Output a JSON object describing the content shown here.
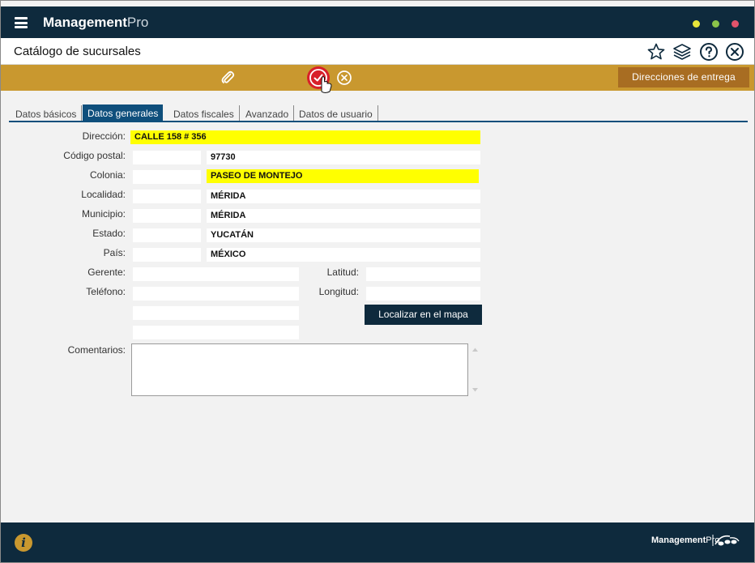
{
  "app": {
    "name_bold": "Management",
    "name_light": "Pro"
  },
  "window_controls": {
    "minimize_color": "#e8e53a",
    "maximize_color": "#8bc34a",
    "close_color": "#e2536b"
  },
  "header": {
    "title": "Catálogo de sucursales"
  },
  "header_icons": [
    "star-icon",
    "layers-icon",
    "help-icon",
    "close-icon"
  ],
  "actionbar": {
    "icons": [
      "paperclip-icon",
      "check-icon",
      "cancel-icon"
    ],
    "direcciones_label": "Direcciones de entrega"
  },
  "tabs": [
    {
      "label": "Datos básicos",
      "active": false
    },
    {
      "label": "Datos generales",
      "active": true
    },
    {
      "label": "Datos fiscales",
      "active": false
    },
    {
      "label": "Avanzado",
      "active": false
    },
    {
      "label": "Datos de usuario",
      "active": false
    }
  ],
  "form": {
    "direccion": {
      "label": "Dirección:",
      "value": "CALLE 158 # 356"
    },
    "codigo_postal": {
      "label": "Código postal:",
      "code": "",
      "value": "97730"
    },
    "colonia": {
      "label": "Colonia:",
      "code": "",
      "value": "PASEO DE MONTEJO"
    },
    "localidad": {
      "label": "Localidad:",
      "code": "",
      "value": "MÉRIDA"
    },
    "municipio": {
      "label": "Municipio:",
      "code": "",
      "value": "MÉRIDA"
    },
    "estado": {
      "label": "Estado:",
      "code": "",
      "value": "YUCATÁN"
    },
    "pais": {
      "label": "País:",
      "code": "",
      "value": "MÉXICO"
    },
    "gerente": {
      "label": "Gerente:",
      "value": ""
    },
    "telefono": {
      "label": "Teléfono:",
      "value": "",
      "value2": "",
      "value3": ""
    },
    "latitud": {
      "label": "Latitud:",
      "value": ""
    },
    "longitud": {
      "label": "Longitud:",
      "value": ""
    },
    "map_button": "Localizar en el mapa",
    "comentarios": {
      "label": "Comentarios:",
      "value": ""
    }
  },
  "footer": {
    "brand_bold": "Management",
    "brand_light": "Pro",
    "info_icon": "i"
  },
  "colors": {
    "navy": "#0e2a3d",
    "gold": "#c9982f",
    "tab_blue": "#0f4f7c",
    "highlight": "#ffff00"
  }
}
